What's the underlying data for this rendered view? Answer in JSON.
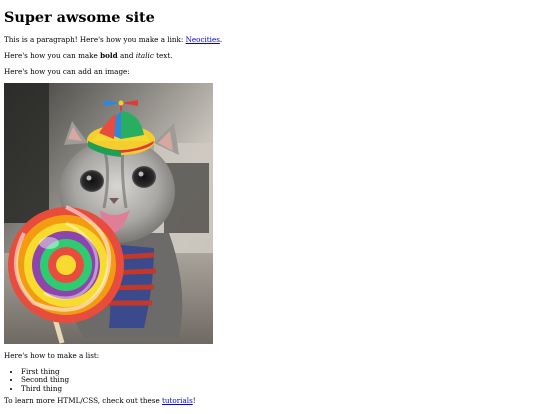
{
  "page": {
    "title": "Super awsome site",
    "para1": {
      "text": "This is a paragraph! Here's how you make a link: ",
      "link": "Neocities",
      "tail": "."
    },
    "para2": {
      "pre": "Here's how you can make ",
      "bold": "bold",
      "mid": " and ",
      "italic": "italic",
      "tail": " text."
    },
    "para3": "Here's how you can add an image:",
    "image": {
      "alt": "Gray kitten wearing a rainbow propeller beanie, licking a giant rainbow swirl lollipop"
    },
    "list_intro": "Here's how to make a list:",
    "list": [
      "First thing",
      "Second thing",
      "Third thing"
    ],
    "footer": {
      "pre": "To learn more HTML/CSS, check out these ",
      "link": "tutorials",
      "tail": "!"
    }
  },
  "colors": {
    "link": "#0000ee",
    "text": "#000000",
    "background": "#ffffff"
  }
}
